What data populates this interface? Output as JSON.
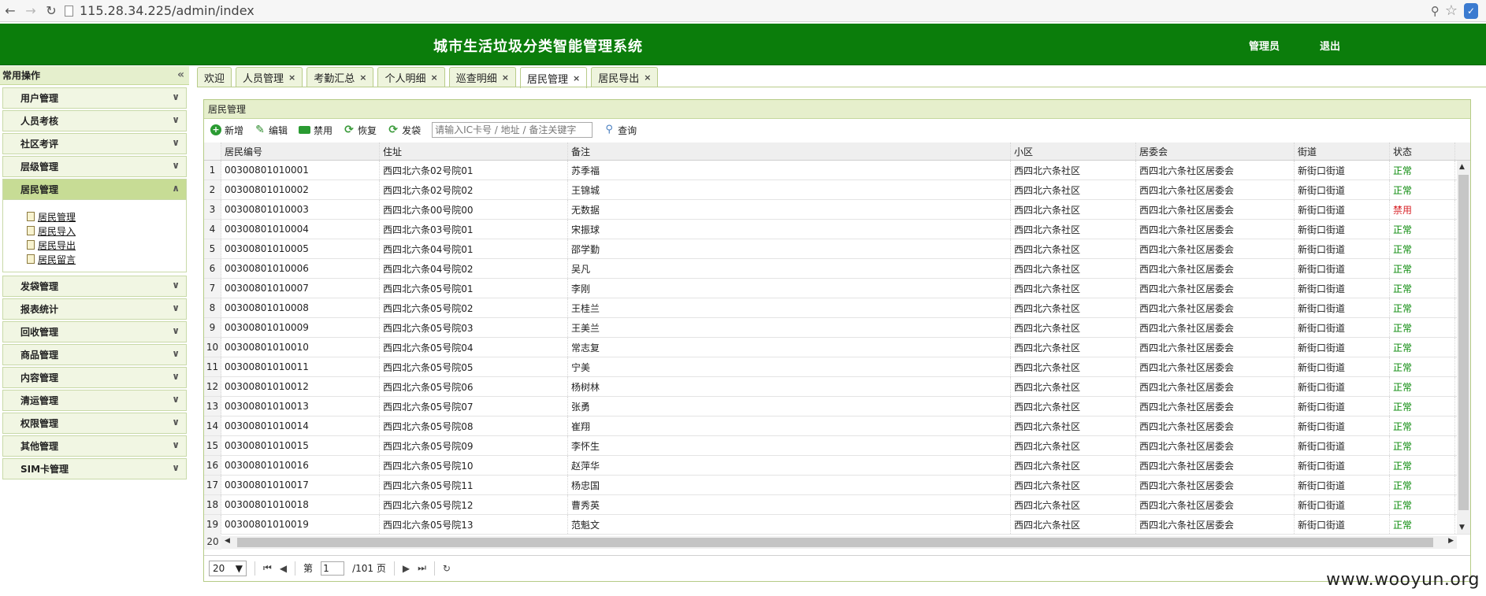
{
  "browser": {
    "url": "115.28.34.225/admin/index"
  },
  "header": {
    "title": "城市生活垃圾分类智能管理系统",
    "user_label": "管理员",
    "logout_label": "退出"
  },
  "sidebar": {
    "title": "常用操作",
    "items": [
      {
        "label": "用户管理"
      },
      {
        "label": "人员考核"
      },
      {
        "label": "社区考评"
      },
      {
        "label": "层级管理"
      },
      {
        "label": "居民管理"
      },
      {
        "label": "发袋管理"
      },
      {
        "label": "报表统计"
      },
      {
        "label": "回收管理"
      },
      {
        "label": "商品管理"
      },
      {
        "label": "内容管理"
      },
      {
        "label": "清运管理"
      },
      {
        "label": "权限管理"
      },
      {
        "label": "其他管理"
      },
      {
        "label": "SIM卡管理"
      }
    ],
    "sub_items": [
      {
        "label": "居民管理"
      },
      {
        "label": "居民导入"
      },
      {
        "label": "居民导出"
      },
      {
        "label": "居民留言"
      }
    ]
  },
  "tabs": [
    {
      "label": "欢迎",
      "closable": false
    },
    {
      "label": "人员管理",
      "closable": true
    },
    {
      "label": "考勤汇总",
      "closable": true
    },
    {
      "label": "个人明细",
      "closable": true
    },
    {
      "label": "巡查明细",
      "closable": true
    },
    {
      "label": "居民管理",
      "closable": true,
      "active": true
    },
    {
      "label": "居民导出",
      "closable": true
    }
  ],
  "panel": {
    "title": "居民管理"
  },
  "toolbar": {
    "add_label": "新增",
    "edit_label": "编辑",
    "disable_label": "禁用",
    "restore_label": "恢复",
    "issue_label": "发袋",
    "search_placeholder": "请输入IC卡号 / 地址 / 备注关键字",
    "query_label": "查询"
  },
  "grid": {
    "columns": [
      "居民编号",
      "住址",
      "备注",
      "小区",
      "居委会",
      "街道",
      "状态"
    ],
    "rows": [
      {
        "n": "1",
        "id": "00300801010001",
        "addr": "西四北六条02号院01",
        "note": "苏季福",
        "comm": "西四北六条社区",
        "cmte": "西四北六条社区居委会",
        "street": "新街口街道",
        "status": "正常"
      },
      {
        "n": "2",
        "id": "00300801010002",
        "addr": "西四北六条02号院02",
        "note": "王锦城",
        "comm": "西四北六条社区",
        "cmte": "西四北六条社区居委会",
        "street": "新街口街道",
        "status": "正常"
      },
      {
        "n": "3",
        "id": "00300801010003",
        "addr": "西四北六条00号院00",
        "note": "无数据",
        "comm": "西四北六条社区",
        "cmte": "西四北六条社区居委会",
        "street": "新街口街道",
        "status": "禁用"
      },
      {
        "n": "4",
        "id": "00300801010004",
        "addr": "西四北六条03号院01",
        "note": "宋振球",
        "comm": "西四北六条社区",
        "cmte": "西四北六条社区居委会",
        "street": "新街口街道",
        "status": "正常"
      },
      {
        "n": "5",
        "id": "00300801010005",
        "addr": "西四北六条04号院01",
        "note": "邵学勤",
        "comm": "西四北六条社区",
        "cmte": "西四北六条社区居委会",
        "street": "新街口街道",
        "status": "正常"
      },
      {
        "n": "6",
        "id": "00300801010006",
        "addr": "西四北六条04号院02",
        "note": "吴凡",
        "comm": "西四北六条社区",
        "cmte": "西四北六条社区居委会",
        "street": "新街口街道",
        "status": "正常"
      },
      {
        "n": "7",
        "id": "00300801010007",
        "addr": "西四北六条05号院01",
        "note": "李刚",
        "comm": "西四北六条社区",
        "cmte": "西四北六条社区居委会",
        "street": "新街口街道",
        "status": "正常"
      },
      {
        "n": "8",
        "id": "00300801010008",
        "addr": "西四北六条05号院02",
        "note": "王桂兰",
        "comm": "西四北六条社区",
        "cmte": "西四北六条社区居委会",
        "street": "新街口街道",
        "status": "正常"
      },
      {
        "n": "9",
        "id": "00300801010009",
        "addr": "西四北六条05号院03",
        "note": "王美兰",
        "comm": "西四北六条社区",
        "cmte": "西四北六条社区居委会",
        "street": "新街口街道",
        "status": "正常"
      },
      {
        "n": "10",
        "id": "00300801010010",
        "addr": "西四北六条05号院04",
        "note": "常志复",
        "comm": "西四北六条社区",
        "cmte": "西四北六条社区居委会",
        "street": "新街口街道",
        "status": "正常"
      },
      {
        "n": "11",
        "id": "00300801010011",
        "addr": "西四北六条05号院05",
        "note": "宁美",
        "comm": "西四北六条社区",
        "cmte": "西四北六条社区居委会",
        "street": "新街口街道",
        "status": "正常"
      },
      {
        "n": "12",
        "id": "00300801010012",
        "addr": "西四北六条05号院06",
        "note": "杨树林",
        "comm": "西四北六条社区",
        "cmte": "西四北六条社区居委会",
        "street": "新街口街道",
        "status": "正常"
      },
      {
        "n": "13",
        "id": "00300801010013",
        "addr": "西四北六条05号院07",
        "note": "张勇",
        "comm": "西四北六条社区",
        "cmte": "西四北六条社区居委会",
        "street": "新街口街道",
        "status": "正常"
      },
      {
        "n": "14",
        "id": "00300801010014",
        "addr": "西四北六条05号院08",
        "note": "崔翔",
        "comm": "西四北六条社区",
        "cmte": "西四北六条社区居委会",
        "street": "新街口街道",
        "status": "正常"
      },
      {
        "n": "15",
        "id": "00300801010015",
        "addr": "西四北六条05号院09",
        "note": "李怀生",
        "comm": "西四北六条社区",
        "cmte": "西四北六条社区居委会",
        "street": "新街口街道",
        "status": "正常"
      },
      {
        "n": "16",
        "id": "00300801010016",
        "addr": "西四北六条05号院10",
        "note": "赵萍华",
        "comm": "西四北六条社区",
        "cmte": "西四北六条社区居委会",
        "street": "新街口街道",
        "status": "正常"
      },
      {
        "n": "17",
        "id": "00300801010017",
        "addr": "西四北六条05号院11",
        "note": "杨忠国",
        "comm": "西四北六条社区",
        "cmte": "西四北六条社区居委会",
        "street": "新街口街道",
        "status": "正常"
      },
      {
        "n": "18",
        "id": "00300801010018",
        "addr": "西四北六条05号院12",
        "note": "曹秀英",
        "comm": "西四北六条社区",
        "cmte": "西四北六条社区居委会",
        "street": "新街口街道",
        "status": "正常"
      },
      {
        "n": "19",
        "id": "00300801010019",
        "addr": "西四北六条05号院13",
        "note": "范魁文",
        "comm": "西四北六条社区",
        "cmte": "西四北六条社区居委会",
        "street": "新街口街道",
        "status": "正常"
      }
    ],
    "partial_row_number": "20"
  },
  "pager": {
    "page_size": "20",
    "page_prefix": "第",
    "current_page": "1",
    "total_pages": "/101 页"
  },
  "watermark": "www.wooyun.org",
  "colors": {
    "header_bg": "#0b7d0b",
    "status_ok": "#0a8a0a",
    "status_disabled": "#d8252a"
  }
}
